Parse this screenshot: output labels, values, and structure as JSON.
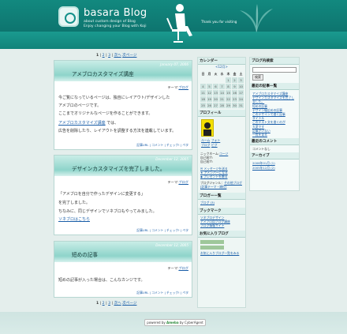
{
  "header": {
    "title": "basara Blog",
    "subtitle1": "about custom design of Blog",
    "subtitle2": "Enjoy changing your Blog with Koji",
    "thanks": "Thank you for visiting"
  },
  "pager_top": {
    "current": "1",
    "p2": "2",
    "p3": "3",
    "next": "次へ",
    "next_page": "次ページ"
  },
  "posts": [
    {
      "date": "January 07, 2006",
      "title": "アメブロカスタマイズ講座",
      "theme_label": "テーマ:",
      "theme": "ブログ",
      "l1": "今ご覧になっているページは、独自にレイアウト/デザインした",
      "l2": "アメブロのページです。",
      "l3": "ここまでオリジナルなページを作ることができます。",
      "l4": "アメブロカスタマイズ講座",
      "l4b": " では、",
      "l5": "広告を削除したり、レイアウトを調整する方法を連載しています。",
      "foot": "記事URL | コメント | チェック! | ペタ"
    },
    {
      "date": "December 12, 2005",
      "title": "デザインカスタマイズを完了しました。",
      "theme_label": "テーマ:",
      "theme": "ブログ",
      "l1": "「アメブロを自分で作ったデザインに変更する」",
      "l2": "を完了しました。",
      "l3": "ちなみに、同じデザインでソネブロもやってみました。",
      "l4": "ソネブロはこちら",
      "foot": "記事URL | コメント | チェック! | ペタ"
    },
    {
      "date": "December 12, 2005",
      "title": "短めの記事",
      "theme_label": "テーマ:",
      "theme": "ブログ",
      "l1": "短めの記事が入った場合は、こんなカンジです。",
      "foot": "記事URL | コメント | チェック! | ペタ"
    }
  ],
  "pager_bottom": {
    "current": "1",
    "p2": "2",
    "p3": "3",
    "next": "次へ",
    "next_page": "次ページ"
  },
  "calendar": {
    "title": "カレンダー",
    "month": "<12月>",
    "days": [
      "日",
      "月",
      "火",
      "水",
      "木",
      "金",
      "土"
    ],
    "dates": [
      "",
      "",
      "",
      "",
      "1",
      "2",
      "3",
      "4",
      "5",
      "6",
      "7",
      "8",
      "9",
      "10",
      "11",
      "12",
      "13",
      "14",
      "15",
      "16",
      "17",
      "18",
      "19",
      "20",
      "21",
      "22",
      "23",
      "24",
      "25",
      "26",
      "27",
      "28",
      "29",
      "30",
      "31"
    ]
  },
  "profile": {
    "title": "プロフィール",
    "name": "ルーム",
    "link2": "フォト",
    "link3": "ブログ",
    "link4": "ピグ",
    "nick": "ニックネーム",
    "nick_link": "コージ",
    "bday": "自己紹介:",
    "msg": "メッセージを送る",
    "amember": "アメンバーになる",
    "present": "プレゼントを贈る",
    "genre_label": "ブログジャンル：",
    "genre": "その他ブログ",
    "ranking": "[記事テーマ・順位]",
    "bday2": "[ブログ・ランキング]"
  },
  "bloggers": {
    "title": "ブロガー一覧",
    "item": "ブログ (3)"
  },
  "bookmarks": {
    "title": "ブックマーク",
    "b1": "ソネブロデザイン",
    "b2": "アメブロ用ブログ講座",
    "b3": "ブログ情報サイト"
  },
  "favorites": {
    "title": "お気に入りブログ",
    "all": "お気に入りブログ一覧をみる"
  },
  "search": {
    "title": "ブログ内検索",
    "button": "検索"
  },
  "recent": {
    "title": "最近の記事一覧",
    "r1": "アメブロカスタマイズ講座",
    "r2": "デザインカスタマイズを完了しました。",
    "r3": "短めの記事",
    "r4": "デザイン幅広めの記事",
    "r5": "このデザインで書く記事",
    "r6": "タイトル",
    "r7": "このテスト文を書くのが",
    "r8": "大変です",
    "r9": "記事が少ない",
    "more": "一覧を見る"
  },
  "comments": {
    "title": "最近のコメント",
    "none": "コメントなし"
  },
  "archive": {
    "title": "アーカイブ",
    "a1": "2006年01月 (1)",
    "a2": "2005年12月 (2)"
  },
  "footer": {
    "powered": "powered by",
    "brand": "Ameba",
    "by": "by CyberAgent"
  },
  "colors": {
    "header": "#0e7670",
    "accent": "#8ed4ca",
    "link": "#1a5ea8"
  }
}
